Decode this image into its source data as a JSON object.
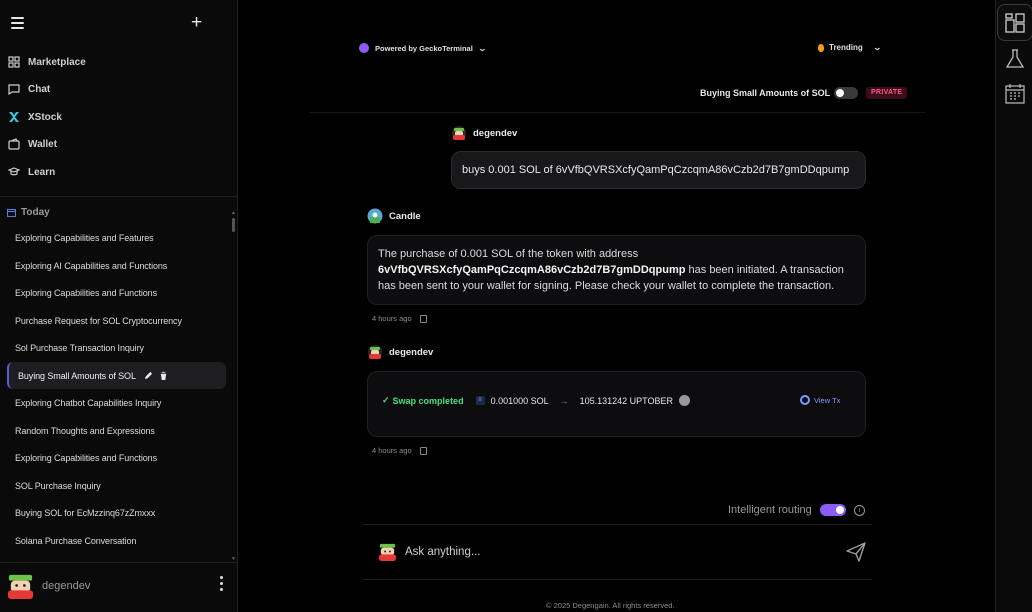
{
  "sidebar": {
    "nav": [
      {
        "label": "Marketplace",
        "icon": "marketplace-icon"
      },
      {
        "label": "Chat",
        "icon": "chat-icon"
      },
      {
        "label": "XStock",
        "icon": "xstock-icon"
      },
      {
        "label": "Wallet",
        "icon": "wallet-icon"
      },
      {
        "label": "Learn",
        "icon": "learn-icon"
      }
    ],
    "section_label": "Today",
    "conversations": [
      "Exploring Capabilities and Features",
      "Exploring AI Capabilities and Functions",
      "Exploring Capabilities and Functions",
      "Purchase Request for SOL Cryptocurrency",
      "Sol Purchase Transaction Inquiry",
      "Buying Small Amounts of SOL",
      "Exploring Chatbot Capabilities Inquiry",
      "Random Thoughts and Expressions",
      "Exploring Capabilities and Functions",
      "SOL Purchase Inquiry",
      "Buying SOL for EcMzzinq67zZmxxx",
      "Solana Purchase Conversation"
    ],
    "active_index": 5,
    "user": {
      "name": "degendev"
    }
  },
  "header": {
    "powered_by": "Powered by GeckoTerminal",
    "trending": "Trending",
    "conversation_title": "Buying Small Amounts of SOL",
    "private_toggle_on": false,
    "private_badge": "PRIVATE"
  },
  "messages": {
    "user1": {
      "name": "degendev",
      "text": "buys 0.001 SOL of 6vVfbQVRSXcfyQamPqCzcqmA86vCzb2d7B7gmDDqpump"
    },
    "bot": {
      "name": "Candle",
      "text_before": "The purchase of 0.001 SOL of the token with address ",
      "address": "6vVfbQVRSXcfyQamPqCzcqmA86vCzb2d7B7gmDDqpump",
      "text_after": " has been initiated. A transaction has been sent to your wallet for signing. Please check your wallet to complete the transaction.",
      "timestamp": "4 hours ago"
    },
    "user2": {
      "name": "degendev",
      "status": "Swap completed",
      "from_amount": "0.001000 SOL",
      "arrow": "→",
      "to_amount": "105.131242 UPTOBER",
      "view_tx": "View Tx",
      "timestamp": "4 hours ago"
    }
  },
  "composer": {
    "routing_label": "Intelligent routing",
    "routing_on": true,
    "placeholder": "Ask anything..."
  },
  "footer": "© 2025 Degengain. All rights reserved.",
  "colors": {
    "accent": "#8b5cf6",
    "success": "#4ade80",
    "private": "#ff5b7f",
    "link": "#7c9cff"
  }
}
